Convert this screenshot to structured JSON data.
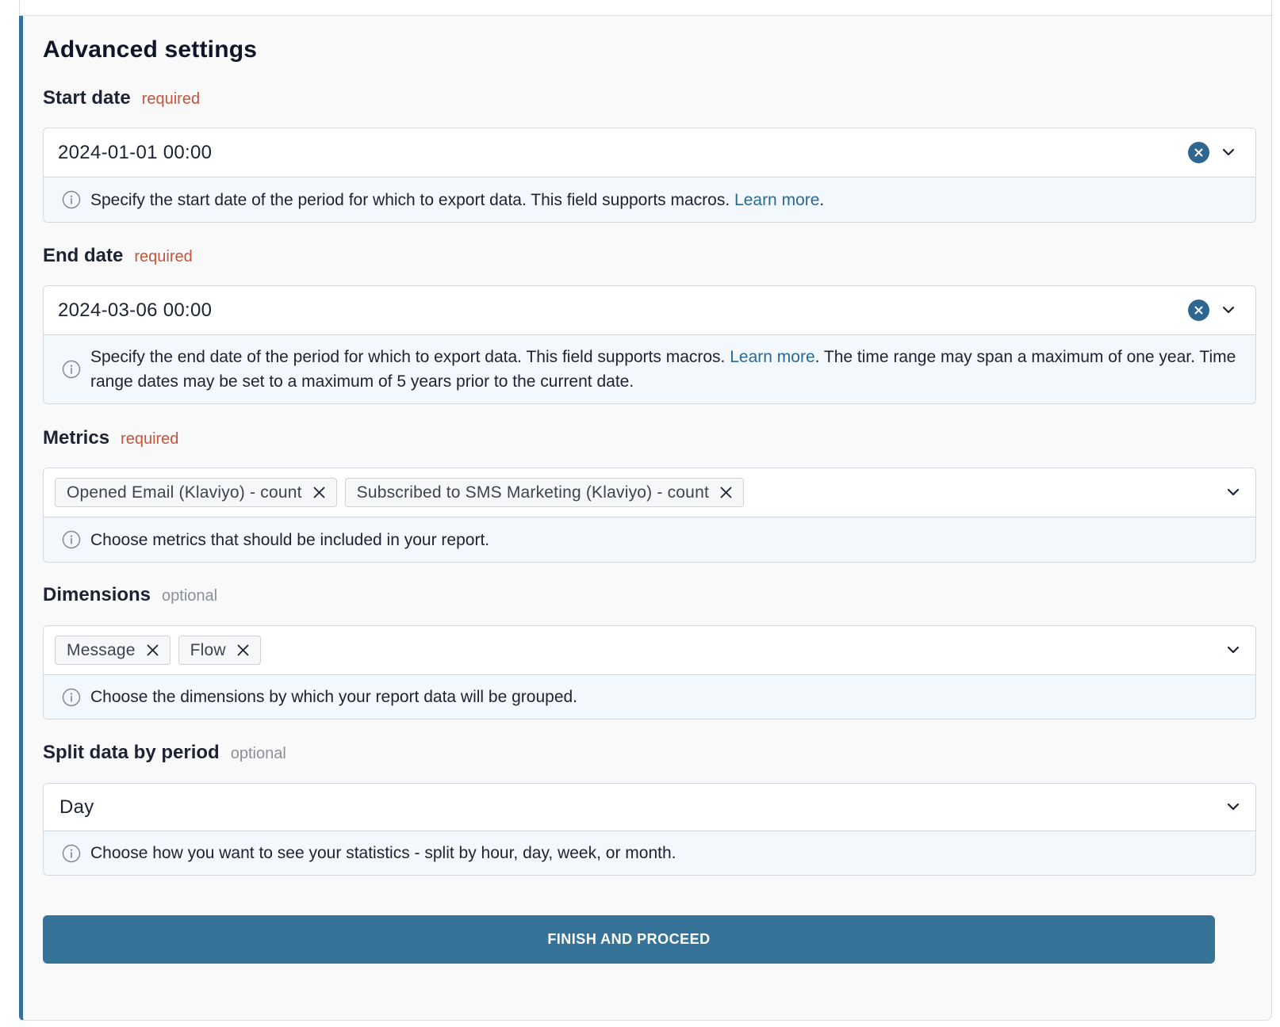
{
  "heading": "Advanced settings",
  "start_date": {
    "label": "Start date",
    "tag": "required",
    "value": "2024-01-01 00:00",
    "help_text": "Specify the start date of the period for which to export data. This field supports macros. ",
    "help_link": "Learn more",
    "help_after": "."
  },
  "end_date": {
    "label": "End date",
    "tag": "required",
    "value": "2024-03-06 00:00",
    "help_text": "Specify the end date of the period for which to export data. This field supports macros. ",
    "help_link": "Learn more",
    "help_after": ". The time range may span a maximum of one year. Time range dates may be set to a maximum of 5 years prior to the current date."
  },
  "metrics": {
    "label": "Metrics",
    "tag": "required",
    "chips": [
      "Opened Email (Klaviyo) - count",
      "Subscribed to SMS Marketing (Klaviyo) - count"
    ],
    "help_text": "Choose metrics that should be included in your report."
  },
  "dimensions": {
    "label": "Dimensions",
    "tag": "optional",
    "chips": [
      "Message",
      "Flow"
    ],
    "help_text": "Choose the dimensions by which your report data will be grouped."
  },
  "split": {
    "label": "Split data by period",
    "tag": "optional",
    "value": "Day",
    "help_text": "Choose how you want to see your statistics - split by hour, day, week, or month."
  },
  "finish_label": "FINISH AND PROCEED",
  "icons": {
    "clear": "clear-circle-icon",
    "dropdown": "chevron-down-icon",
    "info": "info-circle-icon",
    "remove": "close-icon"
  },
  "colors": {
    "accent": "#367399",
    "required": "#c4543d",
    "link": "#2a6a94",
    "help_bg": "#f2f8fc"
  }
}
